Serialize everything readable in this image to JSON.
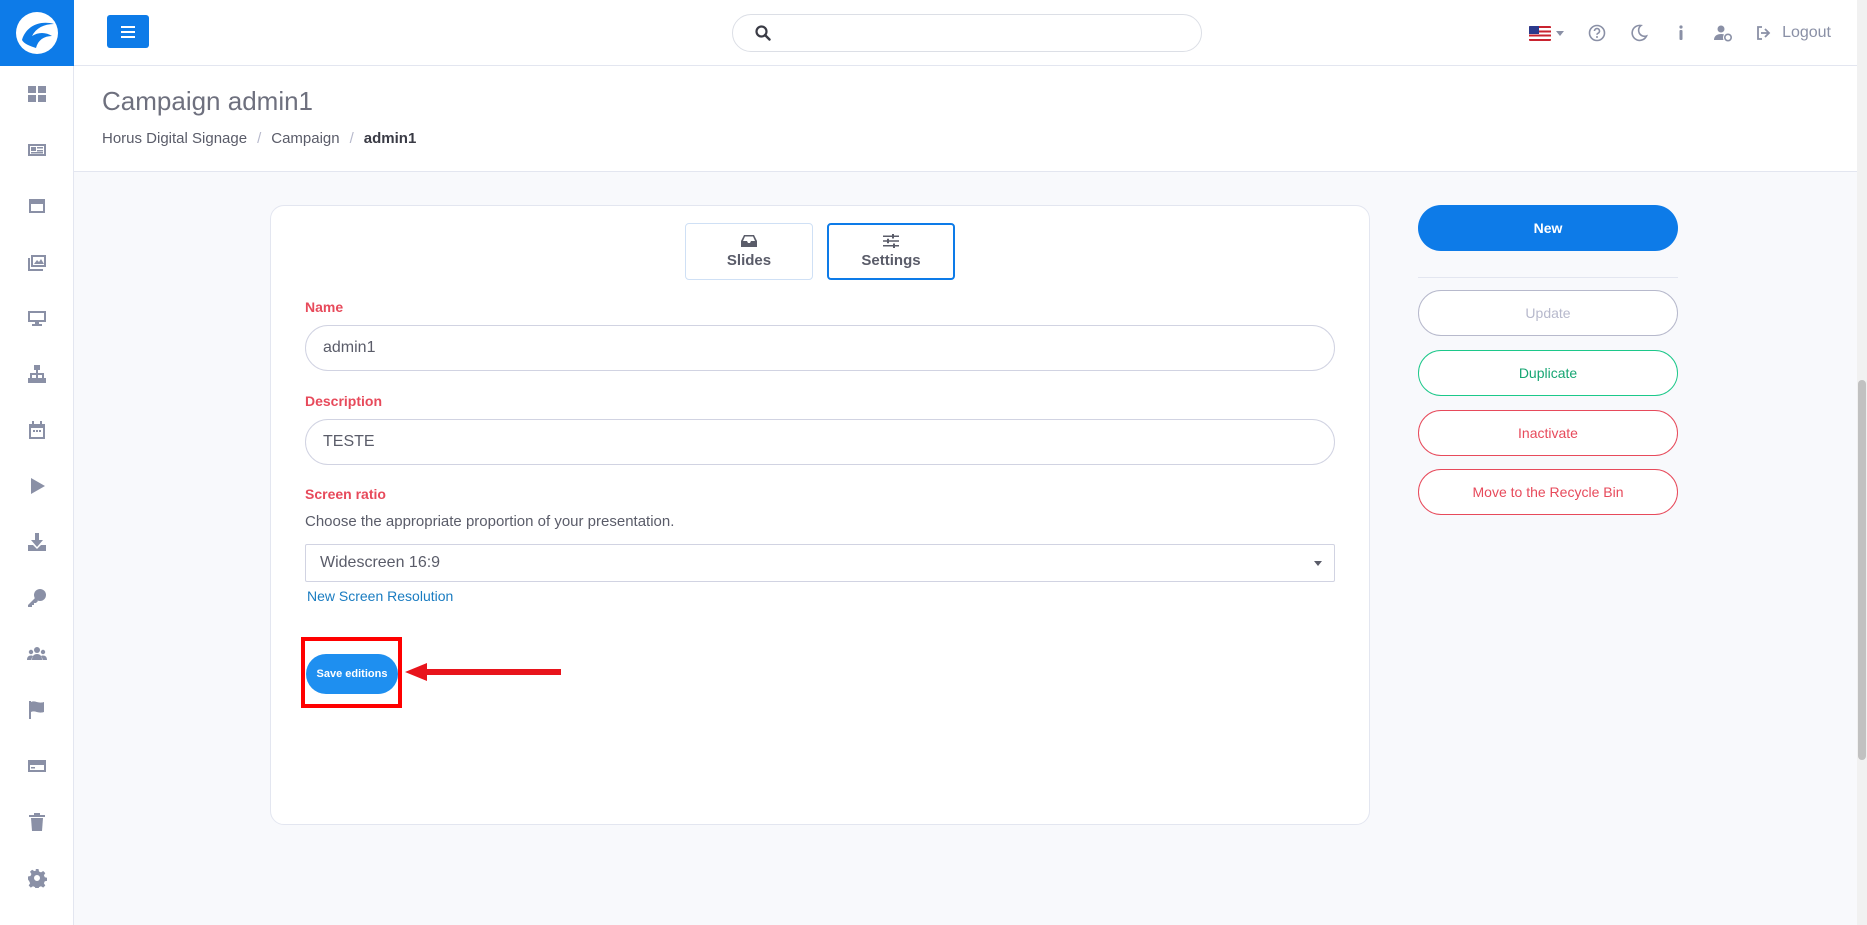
{
  "sidebar": {
    "items": [
      {
        "icon": "dashboard-icon"
      },
      {
        "icon": "newspaper-icon"
      },
      {
        "icon": "window-icon"
      },
      {
        "icon": "images-icon"
      },
      {
        "icon": "monitor-icon"
      },
      {
        "icon": "sitemap-icon"
      },
      {
        "icon": "calendar-icon"
      },
      {
        "icon": "play-icon"
      },
      {
        "icon": "download-icon"
      },
      {
        "icon": "key-icon"
      },
      {
        "icon": "users-icon"
      },
      {
        "icon": "flag-icon"
      },
      {
        "icon": "card-icon"
      },
      {
        "icon": "trash-icon"
      },
      {
        "icon": "gear-icon"
      }
    ]
  },
  "topbar": {
    "search_placeholder": "",
    "logout_label": "Logout"
  },
  "header": {
    "title": "Campaign admin1",
    "breadcrumb": [
      "Horus Digital Signage",
      "Campaign",
      "admin1"
    ]
  },
  "tabs": [
    {
      "label": "Slides",
      "active": false
    },
    {
      "label": "Settings",
      "active": true
    }
  ],
  "form": {
    "name_label": "Name",
    "name_value": "admin1",
    "description_label": "Description",
    "description_value": "TESTE",
    "ratio_label": "Screen ratio",
    "ratio_helper": "Choose the appropriate proportion of your presentation.",
    "ratio_selected": "Widescreen 16:9",
    "new_resolution_link": "New Screen Resolution",
    "save_label": "Save editions"
  },
  "actions": {
    "new_label": "New",
    "update_label": "Update",
    "duplicate_label": "Duplicate",
    "inactivate_label": "Inactivate",
    "recycle_label": "Move to the Recycle Bin"
  },
  "colors": {
    "primary": "#0d7be8",
    "danger": "#e74a5b",
    "success": "#1cc88a",
    "annotation": "#ff0000"
  }
}
